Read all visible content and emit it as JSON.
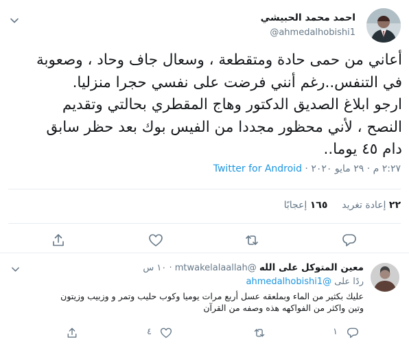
{
  "tweet": {
    "author_name": "احمد محمد الحبيشي",
    "author_handle": "@ahmedalhobishi1",
    "text_lines": [
      "أعاني من حمى حادة ومتقطعة ، وسعال جاف وحاد ، وصعوبة",
      "في التنفس..رغم أنني فرضت على نفسي حجرا منزليا.",
      "ارجو ابلاغ الصديق الدكتور وهاج المقطري بحالتي وتقديم",
      "النصح ، لأني محظور مجددا من الفيس بوك بعد حظر سابق",
      "دام ٤٥ يوما.."
    ],
    "time": "٢:٢٧ م",
    "date": "٢٩ مايو ٢٠٢٠",
    "source": "Twitter for Android",
    "dot": "·",
    "retweets_count": "٢٢",
    "retweets_label": "إعادة تغريد",
    "likes_count": "١٦٥",
    "likes_label": "إعجابًا"
  },
  "reply": {
    "author_name": "معين المتوكل على الله",
    "author_handle": "@mtwakelalaallah",
    "time": "١٠ س",
    "replying_prefix": "ردًا على",
    "replying_to": "@ahmedalhobishi1",
    "text_lines": [
      "عليك بكثير من الماء وبملعقه عسل أربع مرات يوميا وكوب حليب وتمر و وزبيب وزيتون",
      "وتين واكثر من الفواكهه هذه وصفه من القرآن"
    ],
    "replies_count": "١",
    "likes_count": "٤"
  },
  "colors": {
    "text": "#14171a",
    "muted": "#657786",
    "link": "#1b95e0",
    "divider": "#e6ecf0"
  },
  "icons": [
    "chevron-down-icon",
    "share-icon",
    "like-icon",
    "retweet-icon",
    "reply-icon"
  ]
}
